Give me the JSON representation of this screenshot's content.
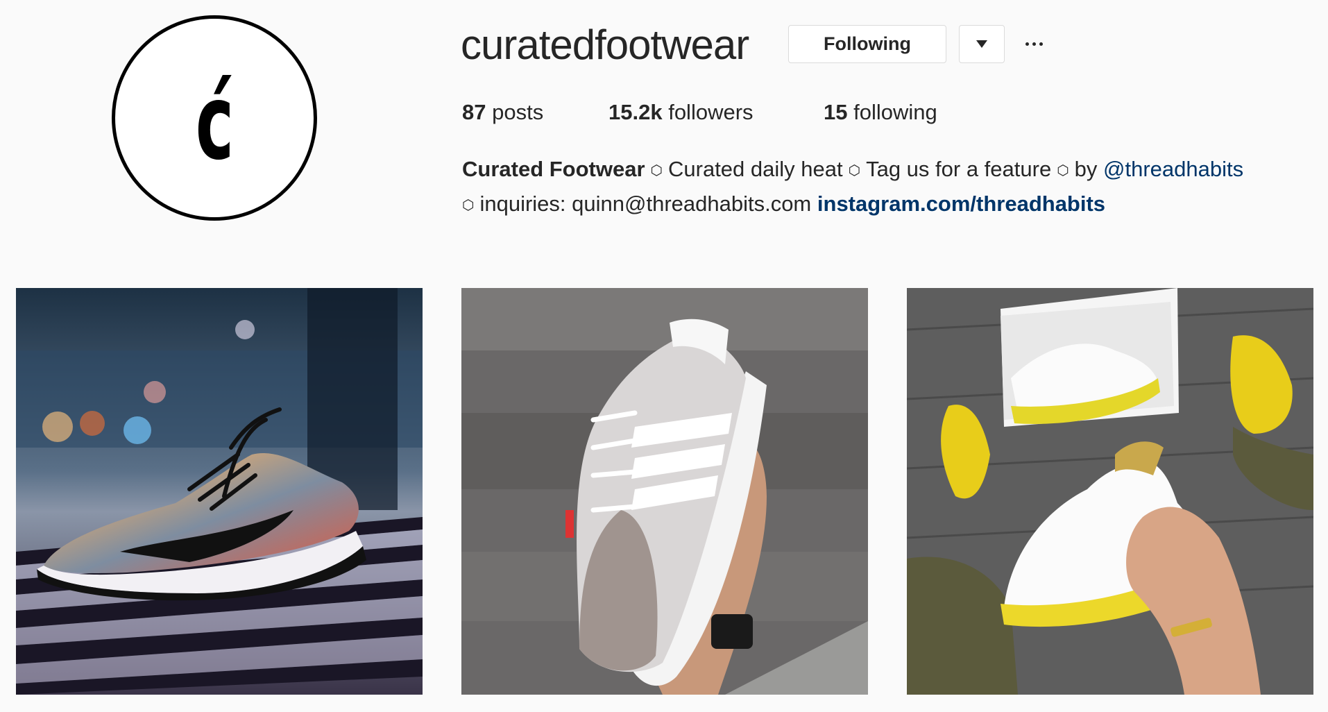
{
  "profile": {
    "avatar_letter": "ć",
    "username": "curatedfootwear",
    "following_button": "Following",
    "dropdown_icon": "chevron-down-icon",
    "more_icon": "more-icon"
  },
  "stats": {
    "posts_count": "87",
    "posts_label": "posts",
    "followers_count": "15.2k",
    "followers_label": "followers",
    "following_count": "15",
    "following_label": "following"
  },
  "bio": {
    "name": "Curated Footwear",
    "separator": "⬡",
    "part1": "Curated daily heat",
    "part2": "Tag us for a feature",
    "part3": "by",
    "mention": "@threadhabits",
    "part4": "inquiries: quinn@threadhabits.com",
    "url": "instagram.com/threadhabits"
  },
  "posts": [
    {
      "subject": "multicolor knit running sneaker on bench"
    },
    {
      "subject": "white knit sneaker held in hand"
    },
    {
      "subject": "white and yellow sneakers with box"
    }
  ],
  "colors": {
    "background": "#fafafa",
    "text": "#262626",
    "link": "#003569",
    "border": "#dbdbdb"
  }
}
